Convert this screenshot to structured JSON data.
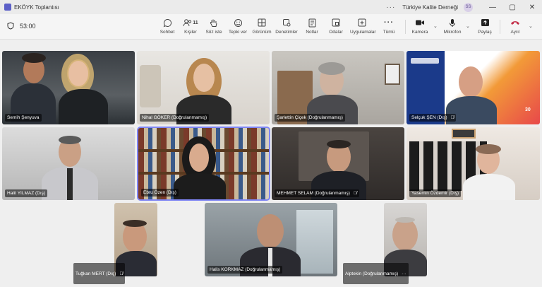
{
  "window": {
    "title": "EKÖYK Toplantısı",
    "org": "Türkiye Kalite Derneği",
    "avatar_initials": "SS"
  },
  "toolbar": {
    "timer": "53:00",
    "items": [
      {
        "label": "Sohbet",
        "icon": "chat-icon"
      },
      {
        "label": "Kişiler",
        "icon": "people-icon",
        "count": "11"
      },
      {
        "label": "Söz iste",
        "icon": "raise-hand-icon"
      },
      {
        "label": "Tepki ver",
        "icon": "emoji-icon"
      },
      {
        "label": "Görünüm",
        "icon": "view-icon"
      },
      {
        "label": "Denetimler",
        "icon": "controls-icon"
      },
      {
        "label": "Notlar",
        "icon": "notes-icon"
      },
      {
        "label": "Odalar",
        "icon": "rooms-icon"
      },
      {
        "label": "Uygulamalar",
        "icon": "apps-icon"
      },
      {
        "label": "Tümü",
        "icon": "more-icon"
      }
    ],
    "camera": "Kamera",
    "mic": "Mikrofon",
    "share": "Paylaş",
    "leave": "Ayrıl"
  },
  "participants": [
    {
      "name": "Semih Şenyuva",
      "muted": false
    },
    {
      "name": "Nihal GÖKER (Doğrulanmamış)",
      "muted": false
    },
    {
      "name": "Şarlettin Çiçek (Doğrulanmamış)",
      "muted": false
    },
    {
      "name": "Selçuk ŞEN (Dış)",
      "muted": true
    },
    {
      "name": "Halit YILMAZ (Dış)",
      "muted": false
    },
    {
      "name": "Ebru Özen (Dış)",
      "muted": false
    },
    {
      "name": "MEHMET SELAM (Doğrulanmamış)",
      "muted": true
    },
    {
      "name": "Yasemin Özdemir (Dış)",
      "muted": false
    },
    {
      "name": "Tuğkan MERT (Dış)",
      "muted": true
    },
    {
      "name": "Halis KORKMAZ (Doğrulanmamış)",
      "muted": false
    },
    {
      "name": "Alptekin (Doğrulanmamış)",
      "muted": false,
      "more": "···"
    }
  ],
  "slide": {
    "number": "30"
  },
  "colors": {
    "accent": "#5b5fc7",
    "leave": "#c4314b",
    "active_outline": "#7f85f5"
  }
}
